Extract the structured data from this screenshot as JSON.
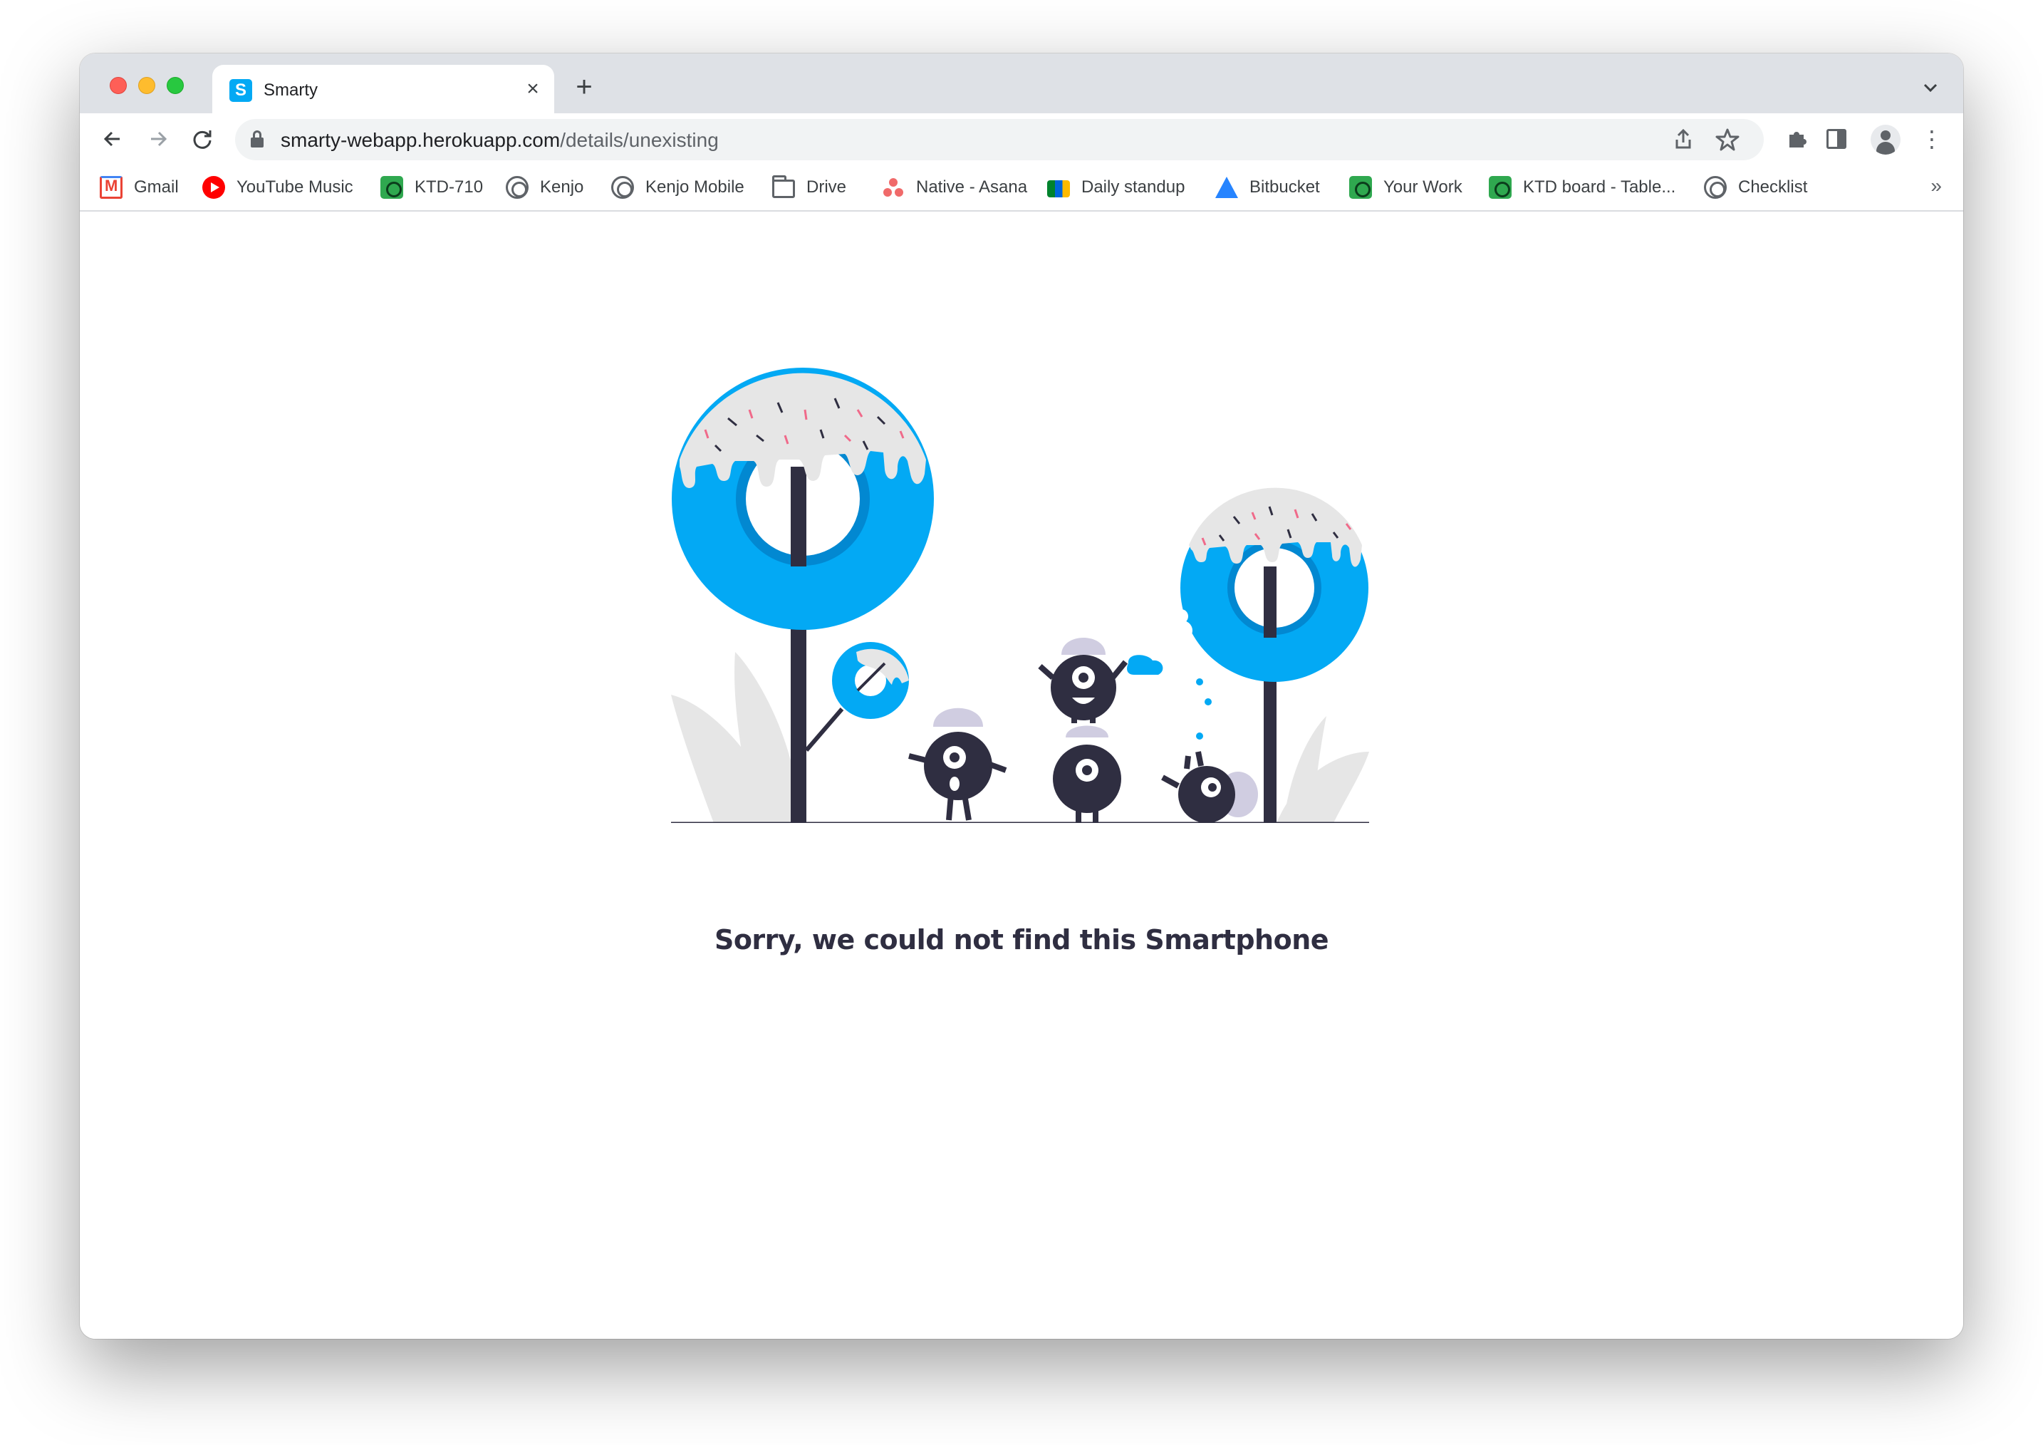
{
  "window": {
    "controls": [
      "close",
      "minimize",
      "zoom"
    ]
  },
  "tab": {
    "favicon_letter": "S",
    "title": "Smarty",
    "close_symbol": "×",
    "new_tab_symbol": "+",
    "search_tabs_symbol": "⌄"
  },
  "toolbar": {
    "back_symbol": "←",
    "forward_symbol": "→",
    "reload_symbol": "↻",
    "url_host": "smarty-webapp.herokuapp.com",
    "url_path": "/details/unexisting",
    "share_symbol": "⇪",
    "bookmark_star_symbol": "☆",
    "extensions_symbol": "✚",
    "menu_symbol": "⋮"
  },
  "bookmarks": {
    "items": [
      {
        "label": "Gmail",
        "icon": "gmail-icon"
      },
      {
        "label": "YouTube Music",
        "icon": "youtube-music-icon"
      },
      {
        "label": "KTD-710",
        "icon": "jira-icon"
      },
      {
        "label": "Kenjo",
        "icon": "kenjo-icon"
      },
      {
        "label": "Kenjo Mobile",
        "icon": "kenjo-icon"
      },
      {
        "label": "Drive",
        "icon": "folder-icon"
      },
      {
        "label": "Native - Asana",
        "icon": "asana-icon"
      },
      {
        "label": "Daily standup",
        "icon": "google-meet-icon"
      },
      {
        "label": "Bitbucket",
        "icon": "bitbucket-icon"
      },
      {
        "label": "Your Work",
        "icon": "jira-icon"
      },
      {
        "label": "KTD board - Table...",
        "icon": "jira-icon"
      },
      {
        "label": "Checklist",
        "icon": "kenjo-icon"
      }
    ],
    "overflow_symbol": "»"
  },
  "page": {
    "message": "Sorry, we could not find this Smartphone",
    "colors": {
      "accent": "#03a9f4",
      "dark": "#2f2e41",
      "icing": "#e6e6e6",
      "monster_cap": "#d0cde1"
    }
  }
}
